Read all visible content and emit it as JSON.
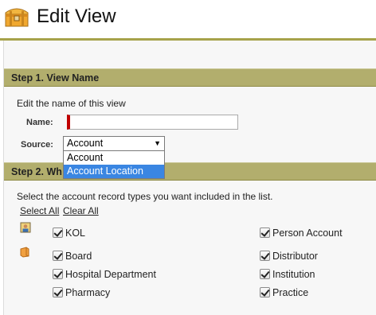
{
  "header": {
    "title": "Edit View"
  },
  "step1": {
    "heading": "Step 1. View Name",
    "instructions": "Edit the name of this view",
    "name_label": "Name:",
    "name_value": "",
    "source_label": "Source:",
    "source_selected": "Account",
    "source_options": [
      "Account",
      "Account Location"
    ],
    "highlighted_option": "Account Location"
  },
  "step2": {
    "heading": "Step 2. Wh",
    "instructions": "Select the account record types you want included in the list.",
    "select_all": "Select All",
    "clear_all": "Clear All",
    "person_types": [
      {
        "label": "KOL",
        "checked": true
      },
      {
        "label": "Person Account",
        "checked": true
      }
    ],
    "business_types": [
      {
        "label": "Board",
        "checked": true
      },
      {
        "label": "Distributor",
        "checked": true
      },
      {
        "label": "Hospital Department",
        "checked": true
      },
      {
        "label": "Institution",
        "checked": true
      },
      {
        "label": "Pharmacy",
        "checked": true
      },
      {
        "label": "Practice",
        "checked": true
      }
    ]
  },
  "colors": {
    "accent_bar": "#b2ae6d",
    "header_rule": "#a6a24a",
    "required_marker": "#c00000",
    "highlight": "#3a86e2"
  }
}
